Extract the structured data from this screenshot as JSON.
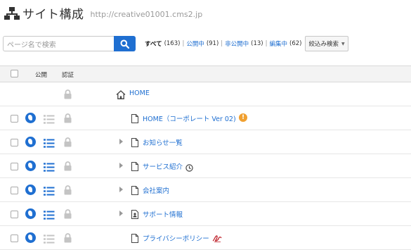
{
  "header": {
    "title": "サイト構成",
    "url": "http://creative01001.cms2.jp"
  },
  "search": {
    "placeholder": "ページ名で検索"
  },
  "filters": [
    {
      "label": "すべて",
      "count": "(163)",
      "active": true
    },
    {
      "label": "公開中",
      "count": "(91)",
      "active": false
    },
    {
      "label": "非公開中",
      "count": "(13)",
      "active": false
    },
    {
      "label": "編集中",
      "count": "(62)",
      "active": false
    }
  ],
  "filter_dropdown": {
    "label": "絞込み検索"
  },
  "table": {
    "col_publish": "公開",
    "col_auth": "認証",
    "rows": [
      {
        "name": "HOME",
        "type": "home",
        "has_controls": false,
        "expandable": false
      },
      {
        "name": "HOME（コーポレート Ver 02)",
        "type": "page",
        "has_controls": true,
        "list_active": false,
        "expandable": false,
        "badge": "!"
      },
      {
        "name": "お知らせ一覧",
        "type": "page",
        "has_controls": true,
        "list_active": true,
        "expandable": true
      },
      {
        "name": "サービス紹介",
        "type": "page",
        "has_controls": true,
        "list_active": true,
        "expandable": true,
        "badge": "clock"
      },
      {
        "name": "会社案内",
        "type": "page",
        "has_controls": true,
        "list_active": true,
        "expandable": true
      },
      {
        "name": "サポート情報",
        "type": "user-page",
        "has_controls": true,
        "list_active": true,
        "expandable": true
      },
      {
        "name": "プライバシーポリシー",
        "type": "page",
        "has_controls": true,
        "list_active": false,
        "expandable": false,
        "badge": "signature"
      }
    ]
  }
}
